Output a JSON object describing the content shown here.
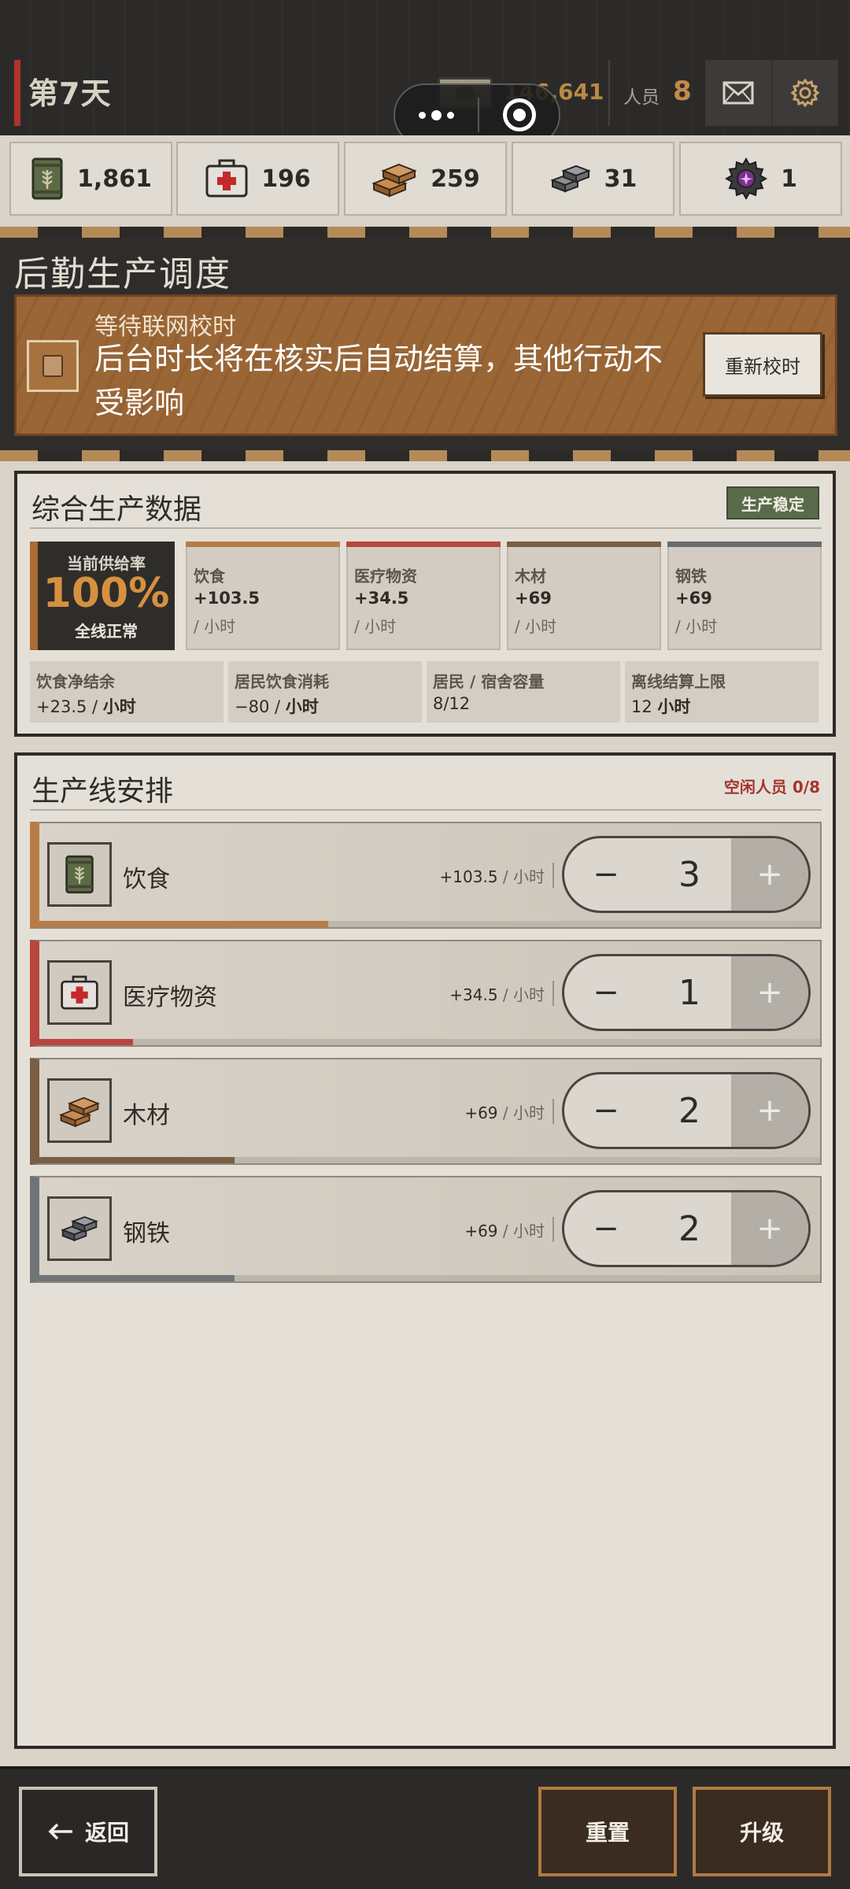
{
  "header": {
    "day": "第7天",
    "money": "146,641",
    "staff_label": "人员",
    "staff_count": "8",
    "icons": {
      "money": "banknote-icon",
      "mail": "envelope-icon",
      "settings": "gear-icon"
    }
  },
  "resources": [
    {
      "name": "food",
      "icon": "grain-can-icon",
      "value": "1,861"
    },
    {
      "name": "medical",
      "icon": "first-aid-kit-icon",
      "value": "196"
    },
    {
      "name": "wood",
      "icon": "wood-planks-icon",
      "value": "259"
    },
    {
      "name": "steel",
      "icon": "steel-ingot-icon",
      "value": "31"
    },
    {
      "name": "gear",
      "icon": "gear-core-icon",
      "value": "1"
    }
  ],
  "logistics": {
    "title": "后勤生产调度",
    "notice_subtitle": "等待联网校时",
    "notice_message": "后台时长将在核实后自动结算，其他行动不受影响",
    "resync_label": "重新校时"
  },
  "production_data": {
    "title": "综合生产数据",
    "badge": "生产稳定",
    "supply_label": "当前供给率",
    "supply_value": "100%",
    "supply_status": "全线正常",
    "rates": [
      {
        "name": "饮食",
        "value": "+103.5",
        "unit": "/ 小时",
        "color": "#b77c45"
      },
      {
        "name": "医疗物资",
        "value": "+34.5",
        "unit": "/ 小时",
        "color": "#b9463e"
      },
      {
        "name": "木材",
        "value": "+69",
        "unit": "/ 小时",
        "color": "#7a5e44"
      },
      {
        "name": "钢铁",
        "value": "+69",
        "unit": "/ 小时",
        "color": "#6b6b6b"
      }
    ],
    "stats": [
      {
        "name": "饮食净结余",
        "value": "+23.5 / ",
        "unit": "小时"
      },
      {
        "name": "居民饮食消耗",
        "value": "−80 / ",
        "unit": "小时"
      },
      {
        "name": "居民 / 宿舍容量",
        "value": "8/12",
        "unit": ""
      },
      {
        "name": "离线结算上限",
        "value": "12 ",
        "unit": "小时"
      }
    ]
  },
  "production_lines": {
    "title": "生产线安排",
    "idle_staff": "空闲人员 0/8",
    "lines": [
      {
        "name": "饮食",
        "icon": "grain-can-icon",
        "rate": "+103.5",
        "unit": " / 小时",
        "count": "3",
        "progress": 0.37,
        "color": "#b77c45"
      },
      {
        "name": "医疗物资",
        "icon": "first-aid-kit-icon",
        "rate": "+34.5",
        "unit": " / 小时",
        "count": "1",
        "progress": 0.12,
        "color": "#b9463e"
      },
      {
        "name": "木材",
        "icon": "wood-planks-icon",
        "rate": "+69",
        "unit": " / 小时",
        "count": "2",
        "progress": 0.25,
        "color": "#7a5e44"
      },
      {
        "name": "钢铁",
        "icon": "steel-ingot-icon",
        "rate": "+69",
        "unit": " / 小时",
        "count": "2",
        "progress": 0.25,
        "color": "#6f7577"
      }
    ],
    "minus_label": "−",
    "plus_label": "+"
  },
  "footer": {
    "back_label": "返回",
    "reset_label": "重置",
    "upgrade_label": "升级"
  }
}
